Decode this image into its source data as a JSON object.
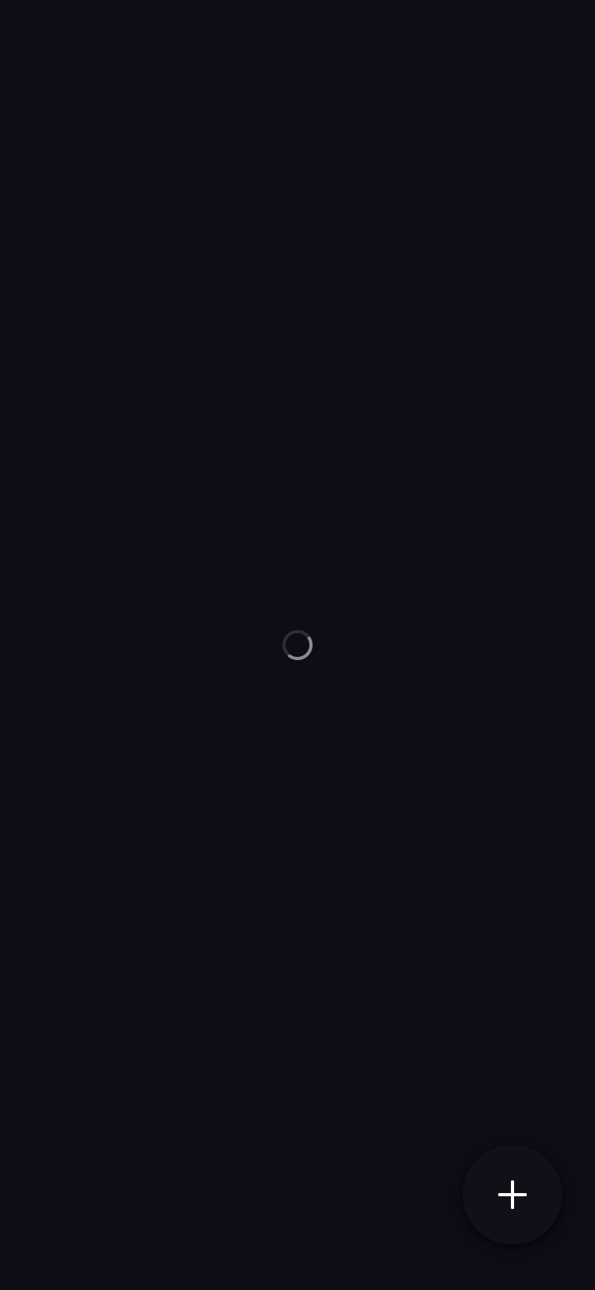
{
  "screen": {
    "background_color": "#0d0e15",
    "state": "loading"
  },
  "loading_indicator": {
    "icon": "spinner-icon",
    "track_color": "#2c2d35",
    "arc_color": "#8a8b92"
  },
  "fab": {
    "icon": "plus-icon",
    "icon_color": "#ffffff",
    "background_color": "#0f1018"
  }
}
